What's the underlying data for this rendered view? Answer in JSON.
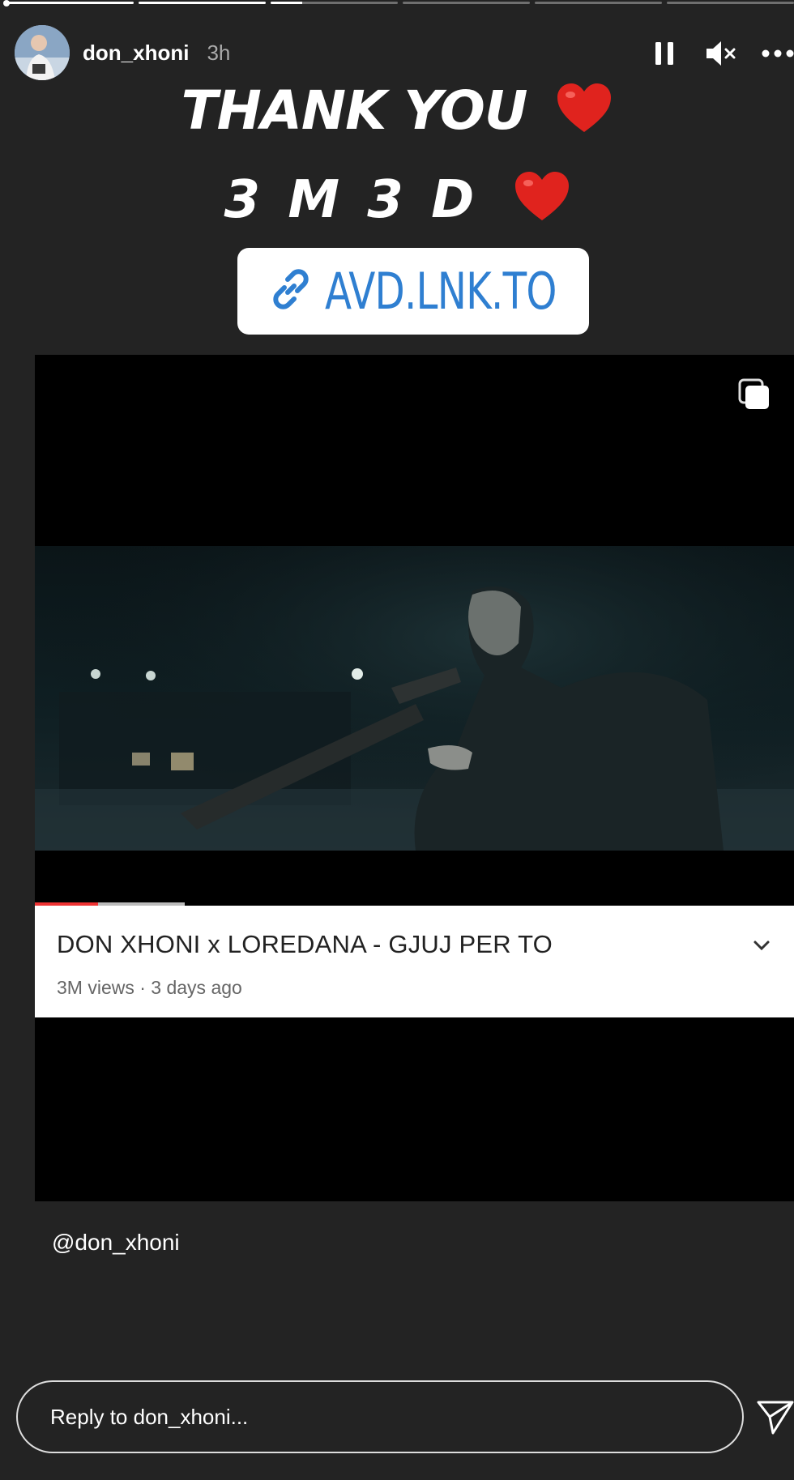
{
  "story": {
    "progress_segments": [
      1.0,
      1.0,
      0.25,
      0.0,
      0.0,
      0.0
    ],
    "username": "don_xhoni",
    "time": "3h"
  },
  "icons": {
    "pause": "pause-icon",
    "mute": "mute-icon",
    "more": "more-icon",
    "link": "link-icon",
    "copy": "multiple-posts-icon",
    "chevron": "chevron-down-icon",
    "send": "send-icon",
    "heart": "red-heart-emoji"
  },
  "text_overlay": {
    "line1": "THANK YOU",
    "line2": "3 M 3 D"
  },
  "link_sticker": {
    "label": "AVD.LNK.TO",
    "color": "#2f7fd1"
  },
  "video_card": {
    "title": "DON XHONI x LOREDANA - GJUJ PER TO",
    "meta": "3M views · 3 days ago",
    "progress": 0.08,
    "buffered": 0.2
  },
  "mention": "@don_xhoni",
  "reply": {
    "placeholder": "Reply to don_xhoni..."
  }
}
